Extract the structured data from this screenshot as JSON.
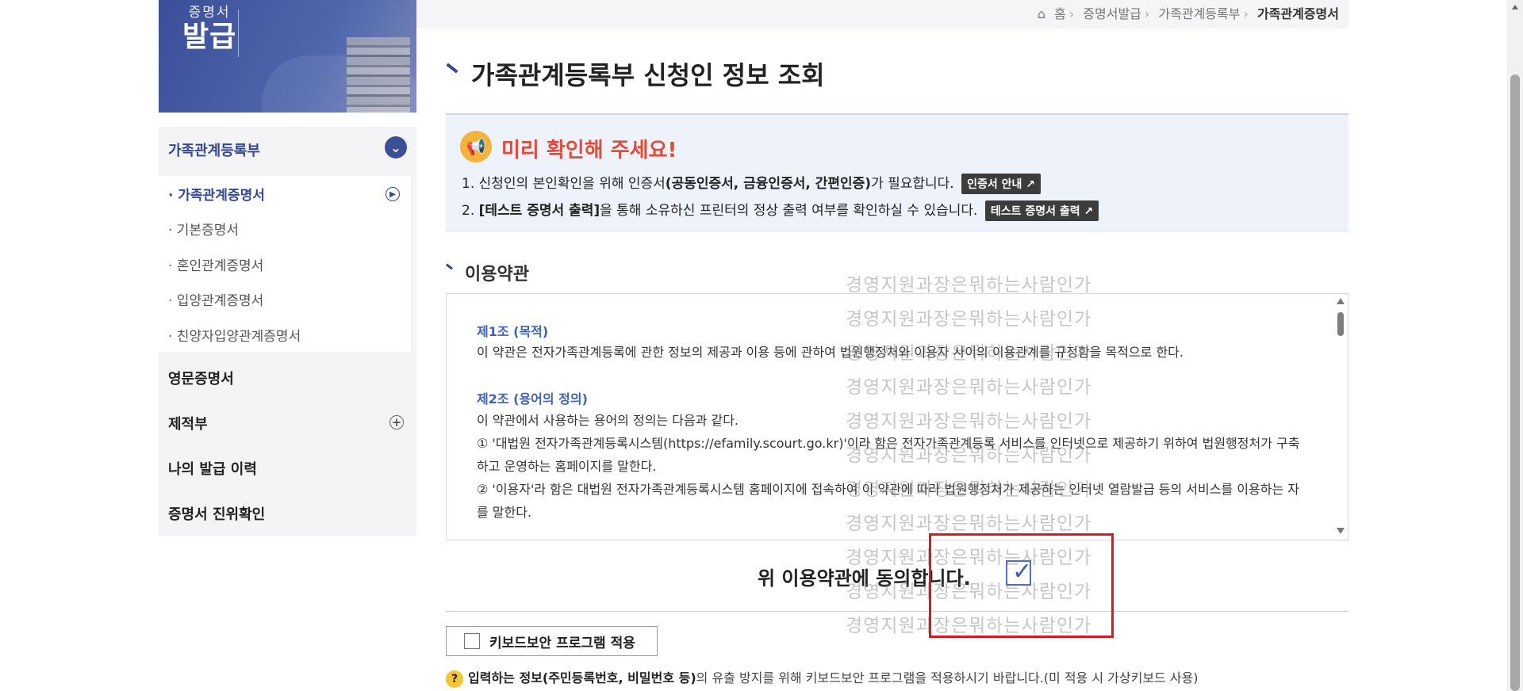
{
  "banner": {
    "logo_line1": "증명서",
    "logo_line2": "발급"
  },
  "breadcrumb": [
    "홈",
    "증명서발급",
    "가족관계등록부",
    "가족관계증명서"
  ],
  "sidebar": {
    "sections": [
      {
        "label": "가족관계등록부",
        "expanded": true
      },
      {
        "label": "영문증명서"
      },
      {
        "label": "제적부"
      },
      {
        "label": "나의 발급 이력"
      },
      {
        "label": "증명서 진위확인"
      }
    ],
    "subitems": [
      {
        "label": "· 가족관계증명서",
        "current": true
      },
      {
        "label": "· 기본증명서"
      },
      {
        "label": "· 혼인관계증명서"
      },
      {
        "label": "· 입양관계증명서"
      },
      {
        "label": "· 친양자입양관계증명서"
      }
    ]
  },
  "page_title": "가족관계등록부 신청인 정보 조회",
  "notice": {
    "heading": "미리 확인해 주세요!",
    "line1_pre": "1. 신청인의 본인확인을 위해 인증서",
    "line1_bold": "(공동인증서, 금융인증서, 간편인증)",
    "line1_post": "가 필요합니다.",
    "line1_button": "인증서 안내 ↗",
    "line2_pre": "2. ",
    "line2_bold": "[테스트 증명서 출력]",
    "line2_post": "을 통해 소유하신 프린터의 정상 출력 여부를 확인하실 수 있습니다.",
    "line2_button": "테스트 증명서 출력 ↗"
  },
  "terms": {
    "title": "이용약관",
    "article1_title": "제1조 (목적)",
    "article1_text": "이 약관은 전자가족관계등록에 관한 정보의 제공과 이용 등에 관하여 법원행정처와 이용자 사이의 이용관계를 규정함을 목적으로 한다.",
    "article2_title": "제2조 (용어의 정의)",
    "article2_intro": "이 약관에서 사용하는 용어의 정의는 다음과 같다.",
    "article2_item1": "① '대법원 전자가족관계등록시스템(https://efamily.scourt.go.kr)'이라 함은 전자가족관계등록 서비스를 인터넷으로 제공하기 위하여 법원행정처가 구축하고 운영하는 홈페이지를 말한다.",
    "article2_item2": "② '이용자'라 함은 대법원 전자가족관계등록시스템 홈페이지에 접속하여 이 약관에 따라 법원행정처가 제공하는 인터넷 열람발급 등의 서비스를 이용하는 자를 말한다."
  },
  "agree": {
    "label": "위 이용약관에 동의합니다.",
    "checked": true
  },
  "keyboard": {
    "button_label": "키보드보안 프로그램 적용",
    "note_icon": "?",
    "note_bold": "입력하는 정보(주민등록번호, 비밀번호 등)",
    "note_rest": "의 유출 방지를 위해 키보드보안 프로그램을 적용하시기 바랍니다.(미 적용 시 가상키보드 사용)"
  },
  "watermark_text": "경영지원과장은뭐하는사람인가",
  "colors": {
    "primary": "#3b4f98",
    "notice_red": "#e24b3b",
    "highlight": "#e0161e"
  }
}
